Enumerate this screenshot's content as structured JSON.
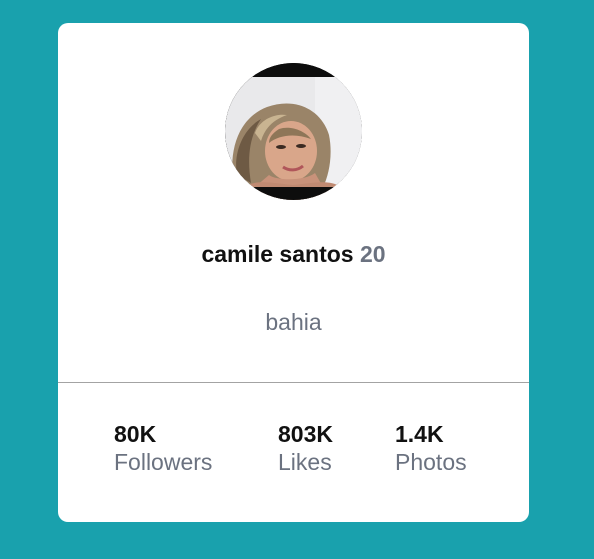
{
  "profile": {
    "name": "camile santos",
    "age": "20",
    "location": "bahia"
  },
  "stats": {
    "followers": {
      "value": "80K",
      "label": "Followers"
    },
    "likes": {
      "value": "803K",
      "label": "Likes"
    },
    "photos": {
      "value": "1.4K",
      "label": "Photos"
    }
  },
  "colors": {
    "background": "#19a1ad",
    "card": "#ffffff",
    "muted_text": "#6b7280"
  }
}
